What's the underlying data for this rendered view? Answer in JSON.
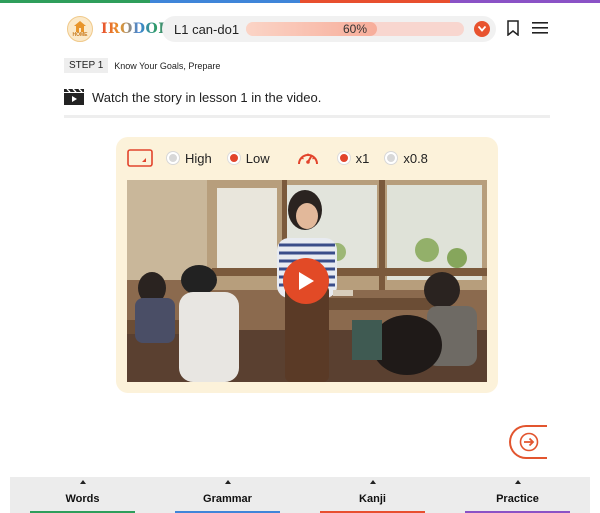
{
  "colors": {
    "accent": "#e2442c",
    "topbar": [
      "#2e9e5b",
      "#3f85d9",
      "#e84f2f",
      "#8a52c6"
    ],
    "nav_underlines": [
      "#2e9e5b",
      "#3f85d9",
      "#e84f2f",
      "#8a52c6"
    ]
  },
  "header": {
    "home_label": "HOME",
    "logo_text": "IRODORI",
    "lesson": "L1 can-do1",
    "progress": 0.6,
    "progress_text": "60%"
  },
  "step": {
    "badge": "STEP 1",
    "text": "Know Your Goals, Prepare"
  },
  "instruction": "Watch the story in lesson 1 in the video.",
  "player": {
    "quality": [
      {
        "label": "High",
        "selected": false
      },
      {
        "label": "Low",
        "selected": true
      }
    ],
    "speed": [
      {
        "label": "x1",
        "selected": true
      },
      {
        "label": "x0.8",
        "selected": false
      }
    ]
  },
  "bottom_nav": [
    {
      "label": "Words"
    },
    {
      "label": "Grammar"
    },
    {
      "label": "Kanji"
    },
    {
      "label": "Practice"
    }
  ]
}
